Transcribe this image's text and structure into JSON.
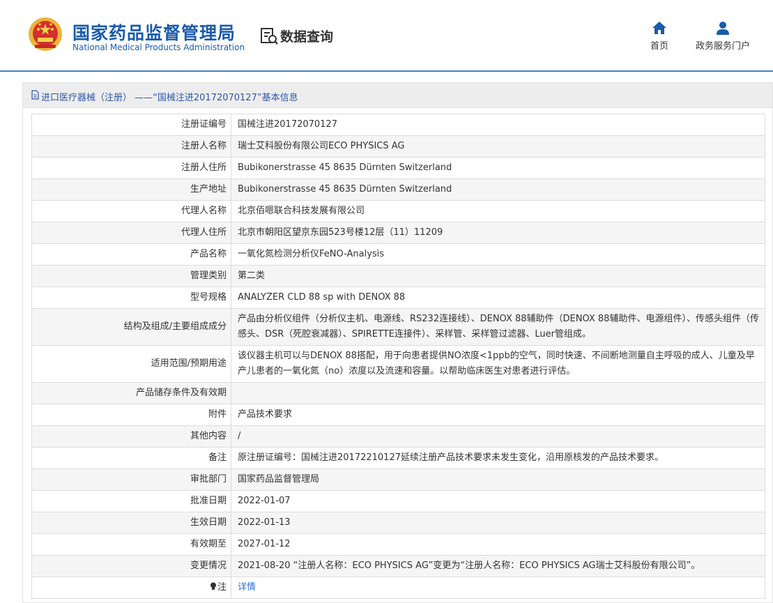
{
  "header": {
    "brand_cn": "国家药品监督管理局",
    "brand_en": "National Medical Products Administration",
    "section_title": "数据查询",
    "nav": [
      {
        "label": "首页",
        "icon": "home-icon"
      },
      {
        "label": "政务服务门户",
        "icon": "user-icon"
      }
    ]
  },
  "colors": {
    "brand": "#1a5baa",
    "header_line": "#4a7fc0",
    "link": "#2c6fcc",
    "row_alt": "#f5f5f5"
  },
  "panel": {
    "title": "进口医疗器械（注册） ——“国械注进20172070127”基本信息",
    "rows": [
      {
        "label": "注册证编号",
        "value": "国械注进20172070127"
      },
      {
        "label": "注册人名称",
        "value": "瑞士艾科股份有限公司ECO PHYSICS AG"
      },
      {
        "label": "注册人住所",
        "value": "Bubikonerstrasse 45 8635 Dürnten Switzerland"
      },
      {
        "label": "生产地址",
        "value": "Bubikonerstrasse 45 8635 Dürnten Switzerland"
      },
      {
        "label": "代理人名称",
        "value": "北京佰嗯联合科技发展有限公司"
      },
      {
        "label": "代理人住所",
        "value": "北京市朝阳区望京东园523号楼12层（11）11209"
      },
      {
        "label": "产品名称",
        "value": "一氧化氮检测分析仪FeNO-Analysis"
      },
      {
        "label": "管理类别",
        "value": "第二类"
      },
      {
        "label": "型号规格",
        "value": "ANALYZER CLD 88 sp with DENOX 88"
      },
      {
        "label": "结构及组成/主要组成成分",
        "value": "产品由分析仪组件（分析仪主机、电源线、RS232连接线）、DENOX 88辅助件（DENOX 88辅助件、电源组件）、传感头组件（传感头、DSR（死腔衰减器）、SPIRETTE连接件）、采样管、采样管过滤器、Luer管组成。"
      },
      {
        "label": "适用范围/预期用途",
        "value": "该仪器主机可以与DENOX 88搭配，用于向患者提供NO浓度<1ppb的空气，同时快速、不间断地测量自主呼吸的成人、儿童及早产儿患者的一氧化氮（no）浓度以及流速和容量。以帮助临床医生对患者进行评估。"
      },
      {
        "label": "产品储存条件及有效期",
        "value": ""
      },
      {
        "label": "附件",
        "value": "产品技术要求"
      },
      {
        "label": "其他内容",
        "value": "/"
      },
      {
        "label": "备注",
        "value": "原注册证编号：国械注进20172210127延续注册产品技术要求未发生变化，沿用原核发的产品技术要求。"
      },
      {
        "label": "审批部门",
        "value": "国家药品监督管理局"
      },
      {
        "label": "批准日期",
        "value": "2022-01-07"
      },
      {
        "label": "生效日期",
        "value": "2022-01-13"
      },
      {
        "label": "有效期至",
        "value": "2027-01-12"
      },
      {
        "label": "变更情况",
        "value": "2021-08-20 “注册人名称：ECO PHYSICS AG”变更为“注册人名称：ECO PHYSICS AG瑞士艾科股份有限公司”。"
      }
    ],
    "note_row": {
      "label": "注",
      "value": "详情",
      "icon": "lightbulb-icon"
    }
  }
}
